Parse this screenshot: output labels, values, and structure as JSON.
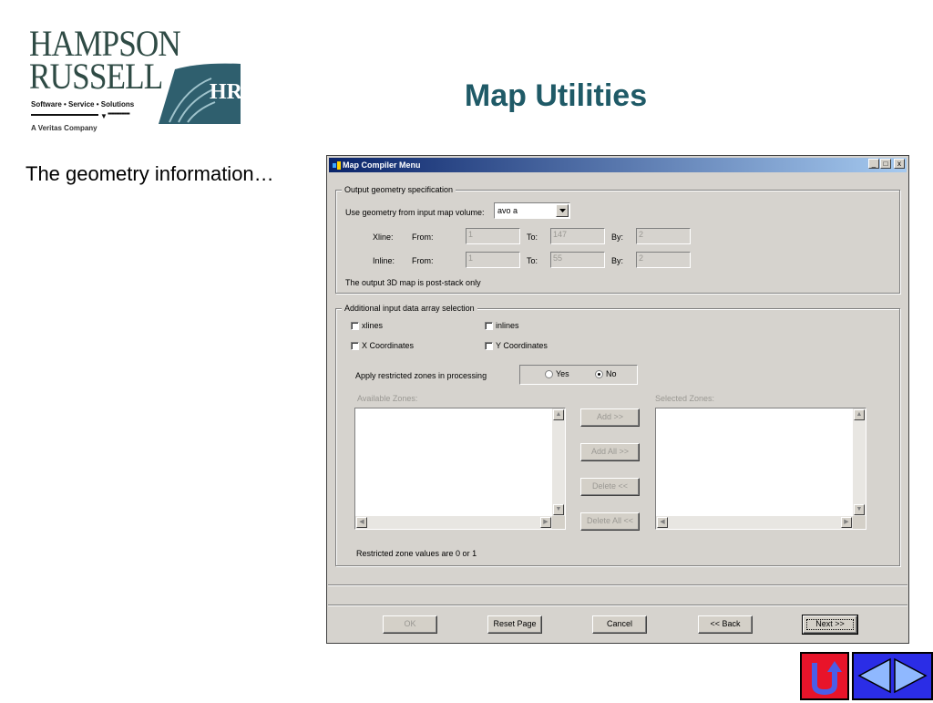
{
  "logo": {
    "line1": "HAMPSON",
    "line2": "RUSSELL",
    "mark": "HR",
    "tagline": "Software • Service • Solutions",
    "dots": "▪▪▪▪▪▪▪▪▪▪▪▪▪",
    "company": "A Veritas Company"
  },
  "slide": {
    "title": "Map Utilities",
    "text": "The geometry information…",
    "title_color": "#1f5a67"
  },
  "window": {
    "title": "Map Compiler Menu",
    "controls": {
      "minimize": "_",
      "maximize": "□",
      "close": "x"
    }
  },
  "output_geometry": {
    "legend": "Output geometry specification",
    "use_label": "Use geometry from input map volume:",
    "volume_value": "avo a",
    "xline": {
      "label": "Xline:",
      "from_label": "From:",
      "from": "1",
      "to_label": "To:",
      "to": "147",
      "by_label": "By:",
      "by": "2"
    },
    "inline": {
      "label": "Inline:",
      "from_label": "From:",
      "from": "1",
      "to_label": "To:",
      "to": "55",
      "by_label": "By:",
      "by": "2"
    },
    "note": "The output 3D map is post-stack only"
  },
  "additional_input": {
    "legend": "Additional input data array selection",
    "xlines": "xlines",
    "inlines": "inlines",
    "x_coords": "X Coordinates",
    "y_coords": "Y Coordinates",
    "apply_label": "Apply restricted zones in processing",
    "yes": "Yes",
    "no": "No",
    "selected_option": "No",
    "available_label": "Available Zones:",
    "selected_label": "Selected Zones:",
    "add": "Add >>",
    "add_all": "Add All >>",
    "delete": "Delete <<",
    "delete_all": "Delete All <<",
    "note": "Restricted zone values are 0 or 1"
  },
  "footer": {
    "ok": "OK",
    "reset": "Reset Page",
    "cancel": "Cancel",
    "back": "<< Back",
    "next": "Next >>"
  },
  "colors": {
    "titlebar_start": "#0a246a",
    "nav_up": "#e8142a",
    "nav_lr": "#2b2de6"
  }
}
